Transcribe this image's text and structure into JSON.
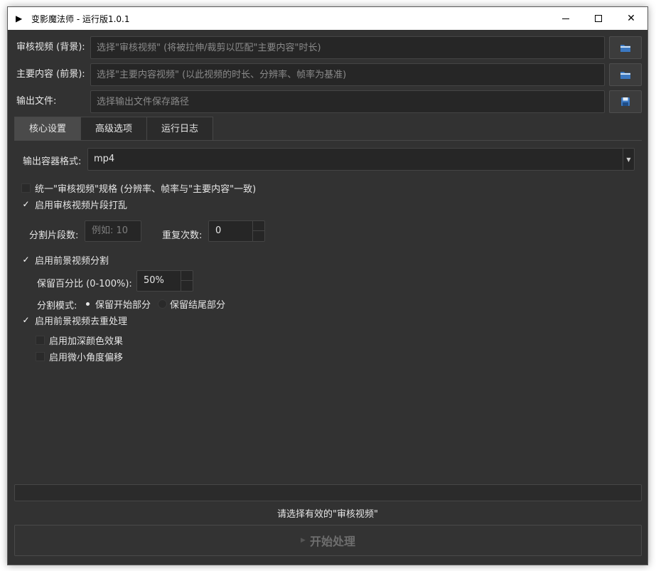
{
  "window": {
    "title": "变影魔法师 - 运行版1.0.1",
    "app_icon": "▶",
    "minimize": "minimize",
    "maximize": "maximize",
    "close": "✕"
  },
  "inputs": [
    {
      "label": "审核视频 (背景):",
      "placeholder": "选择\"审核视频\" (将被拉伸/裁剪以匹配\"主要内容\"时长)",
      "value": "",
      "icon": "folder-icon"
    },
    {
      "label": "主要内容 (前景):",
      "placeholder": "选择\"主要内容视频\" (以此视频的时长、分辨率、帧率为基准)",
      "value": "",
      "icon": "folder-icon"
    },
    {
      "label": "输出文件:",
      "placeholder": "选择输出文件保存路径",
      "value": "",
      "icon": "save-icon"
    }
  ],
  "tabs": [
    {
      "label": "核心设置",
      "active": true
    },
    {
      "label": "高级选项",
      "active": false
    },
    {
      "label": "运行日志",
      "active": false
    }
  ],
  "core": {
    "format_label": "输出容器格式:",
    "format_value": "mp4",
    "unify_label": "统一\"审核视频\"规格 (分辨率、帧率与\"主要内容\"一致)",
    "unify_checked": false,
    "shuffle_label": "启用审核视频片段打乱",
    "shuffle_checked": true,
    "segments_label": "分割片段数:",
    "segments_placeholder": "例如: 10",
    "repeat_label": "重复次数:",
    "repeat_value": "0",
    "split_label": "启用前景视频分割",
    "split_checked": true,
    "keep_label": "保留百分比 (0-100%):",
    "keep_value": "50%",
    "mode_label": "分割模式:",
    "mode_start": "保留开始部分",
    "mode_end": "保留结尾部分",
    "mode_selected": "start",
    "dedup_label": "启用前景视频去重处理",
    "dedup_checked": true,
    "darken_label": "启用加深颜色效果",
    "darken_checked": false,
    "rotate_label": "启用微小角度偏移",
    "rotate_checked": false
  },
  "status": {
    "progress": 0,
    "message": "请选择有效的\"审核视频\"",
    "start_label": "开始处理",
    "start_icon": "▶"
  },
  "check_mark": "✓"
}
